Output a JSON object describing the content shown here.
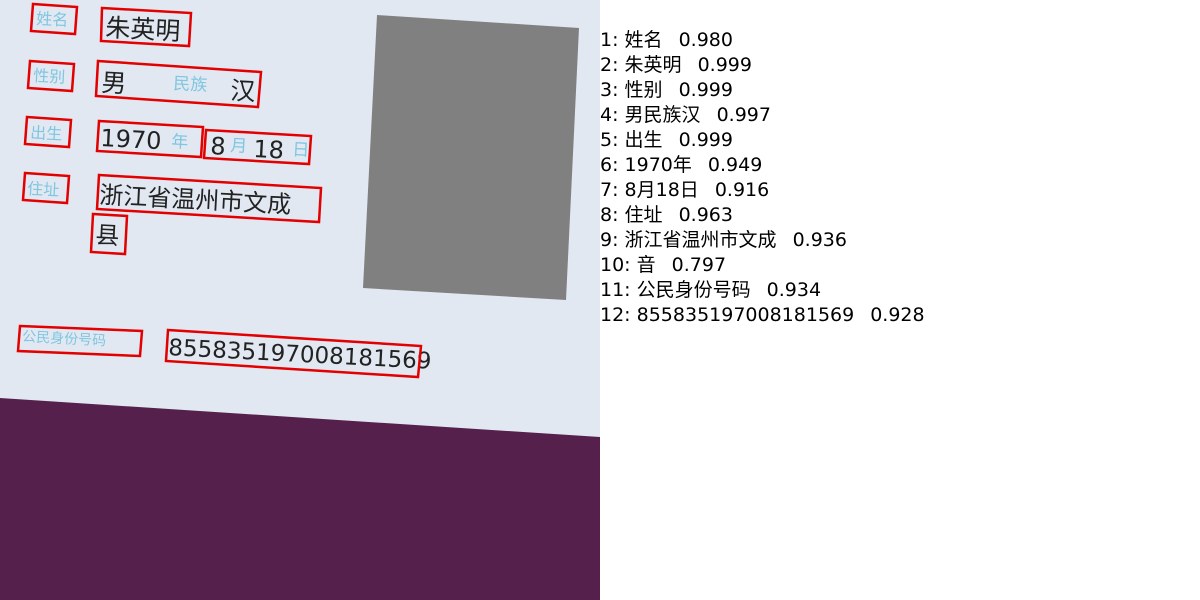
{
  "colors": {
    "card_bg": "#e2e8f2",
    "bottom_bg": "#56204d",
    "photo": "#808080",
    "box_stroke": "#e20000",
    "label_text": "#7fc6e0",
    "value_text": "#222222"
  },
  "card": {
    "labels": {
      "name": "姓名",
      "gender": "性别",
      "ethnicity": "民族",
      "birth": "出生",
      "year_unit": "年",
      "month_unit": "月",
      "day_unit": "日",
      "address": "住址",
      "id_number": "公民身份号码"
    },
    "values": {
      "name": "朱英明",
      "gender": "男",
      "ethnicity": "汉",
      "year": "1970",
      "month": "8",
      "day": "18",
      "address_line1": "浙江省温州市文成",
      "address_line2": "县",
      "id_number": "855835197008181569"
    }
  },
  "results": [
    {
      "index": "1:",
      "text": "姓名",
      "score": "0.980"
    },
    {
      "index": "2:",
      "text": "朱英明",
      "score": "0.999"
    },
    {
      "index": "3:",
      "text": "性别",
      "score": "0.999"
    },
    {
      "index": "4:",
      "text": "男民族汉",
      "score": "0.997"
    },
    {
      "index": "5:",
      "text": "出生",
      "score": "0.999"
    },
    {
      "index": "6:",
      "text": "1970年",
      "score": "0.949"
    },
    {
      "index": "7:",
      "text": "8月18日",
      "score": "0.916"
    },
    {
      "index": "8:",
      "text": "住址",
      "score": "0.963"
    },
    {
      "index": "9:",
      "text": "浙江省温州市文成",
      "score": "0.936"
    },
    {
      "index": "10:",
      "text": "音",
      "score": "0.797"
    },
    {
      "index": "11:",
      "text": "公民身份号码",
      "score": "0.934"
    },
    {
      "index": "12:",
      "text": "855835197008181569",
      "score": "0.928"
    }
  ]
}
